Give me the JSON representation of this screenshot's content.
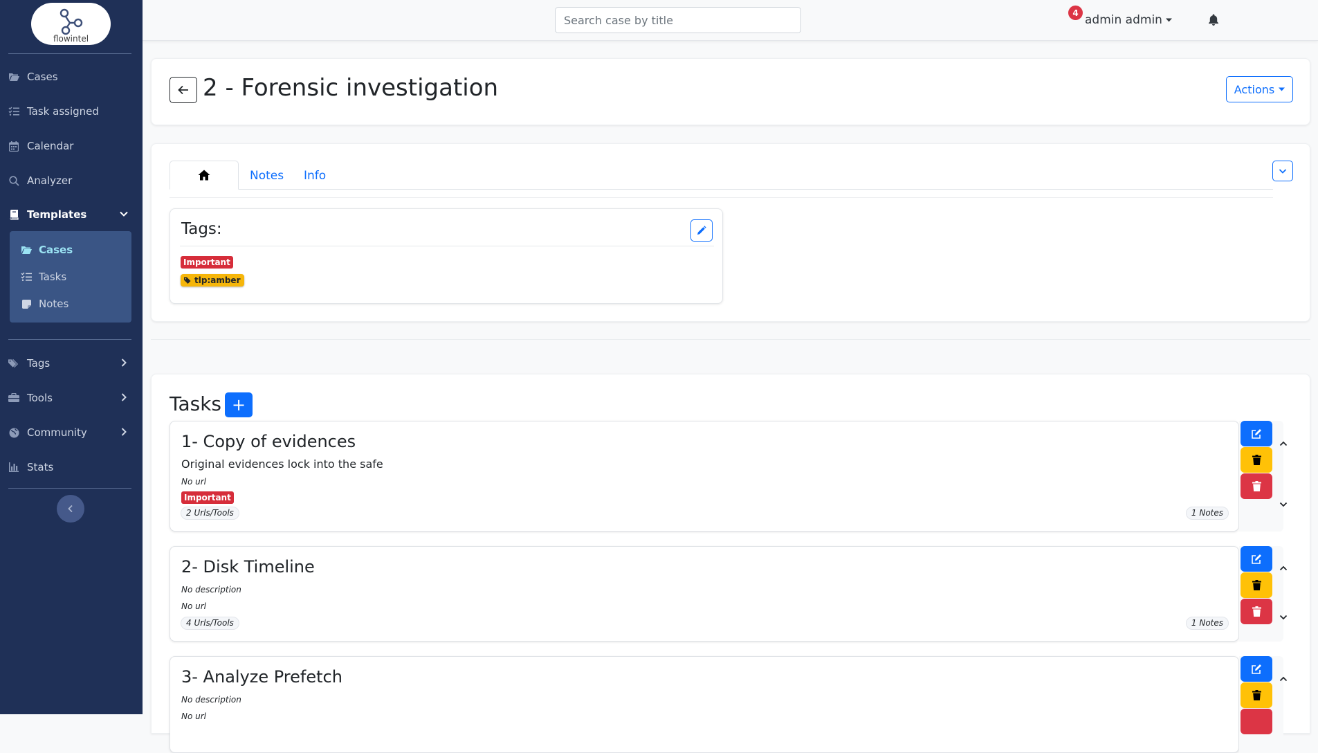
{
  "app": {
    "logo_text": "flowintel"
  },
  "sidebar": {
    "items": [
      {
        "label": "Cases",
        "icon": "folder-open-icon"
      },
      {
        "label": "Task assigned",
        "icon": "list-check-icon"
      },
      {
        "label": "Calendar",
        "icon": "calendar-icon"
      },
      {
        "label": "Analyzer",
        "icon": "search-icon"
      },
      {
        "label": "Templates",
        "icon": "book-icon"
      },
      {
        "label": "Tags",
        "icon": "tags-icon"
      },
      {
        "label": "Tools",
        "icon": "toolbox-icon"
      },
      {
        "label": "Community",
        "icon": "globe-icon"
      },
      {
        "label": "Stats",
        "icon": "chart-bar-icon"
      }
    ],
    "templates_sub": [
      {
        "label": "Cases",
        "icon": "folder-open-icon",
        "active": true
      },
      {
        "label": "Tasks",
        "icon": "list-check-icon"
      },
      {
        "label": "Notes",
        "icon": "sticky-note-icon"
      }
    ]
  },
  "topbar": {
    "search_placeholder": "Search case by title",
    "notification_count": "4",
    "user_name": "admin admin"
  },
  "case": {
    "title": "2 - Forensic investigation",
    "actions_label": "Actions",
    "tabs": [
      "Notes",
      "Info"
    ],
    "tags_title": "Tags:",
    "tags": [
      {
        "label": "Important",
        "color": "#d62d3a"
      },
      {
        "label": "tlp:amber",
        "color": "#f6b60a"
      }
    ]
  },
  "tasks": {
    "title": "Tasks",
    "add_label": "+",
    "items": [
      {
        "title": "1- Copy of evidences",
        "description": "Original evidences lock into the safe",
        "url": "No url",
        "tag": "Important",
        "urls_tools": "2 Urls/Tools",
        "notes": "1 Notes"
      },
      {
        "title": "2- Disk Timeline",
        "description": "No description",
        "url": "No url",
        "urls_tools": "4 Urls/Tools",
        "notes": "1 Notes"
      },
      {
        "title": "3- Analyze Prefetch",
        "description": "No description",
        "url": "No url"
      }
    ]
  },
  "colors": {
    "sidebar_bg": "#1f3057",
    "primary": "#0d6efd",
    "warning": "#ffc107",
    "danger": "#dc3545"
  }
}
